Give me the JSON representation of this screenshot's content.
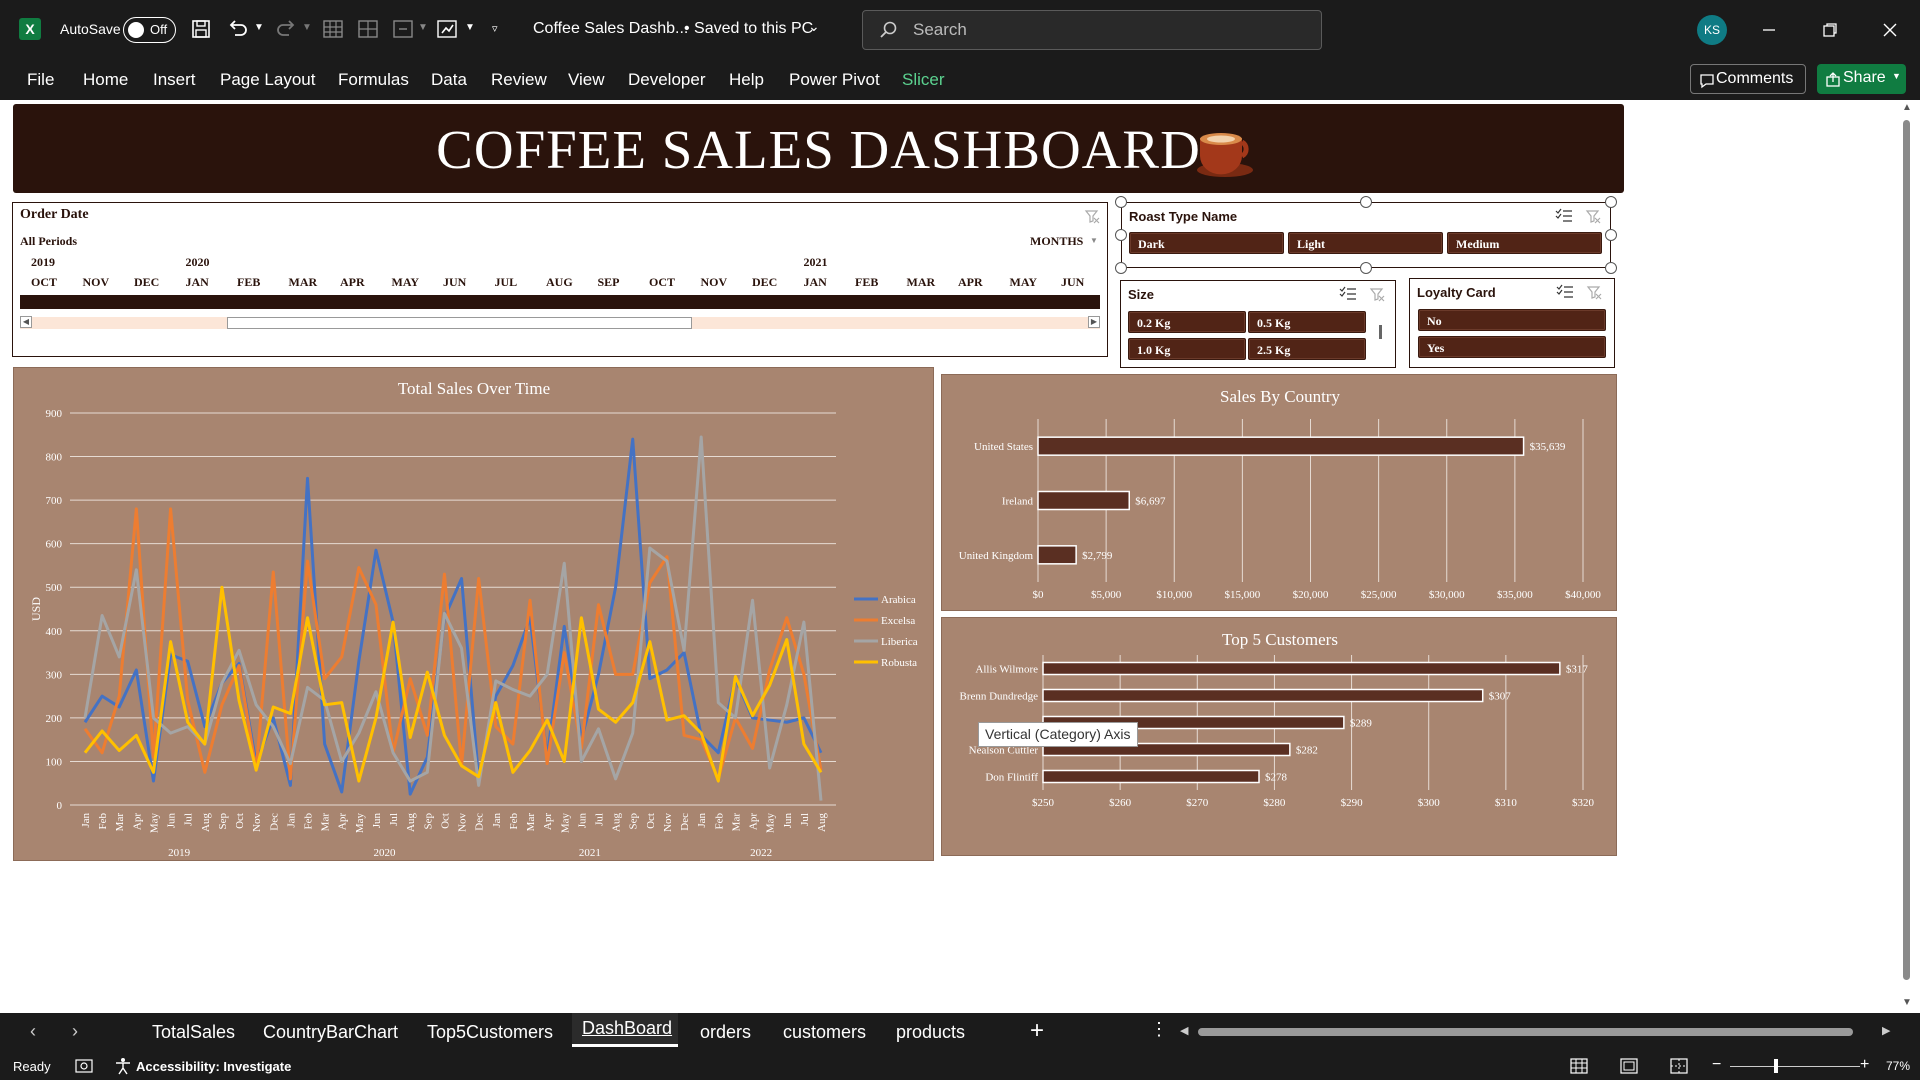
{
  "titlebar": {
    "autosave_label": "AutoSave",
    "autosave_state": "Off",
    "doc_title": "Coffee Sales Dashb...",
    "save_status": "• Saved to this PC",
    "search_placeholder": "Search",
    "user_initials": "KS"
  },
  "ribbon": {
    "tabs": [
      "File",
      "Home",
      "Insert",
      "Page Layout",
      "Formulas",
      "Data",
      "Review",
      "View",
      "Developer",
      "Help",
      "Power Pivot",
      "Slicer"
    ],
    "active_tab": "Slicer",
    "comments_label": "Comments",
    "share_label": "Share"
  },
  "dashboard": {
    "title": "COFFEE  SALES DASHBOARD"
  },
  "timeline": {
    "title": "Order Date",
    "period_label": "All Periods",
    "unit_label": "MONTHS",
    "years": [
      "2019",
      "2020",
      "2021"
    ],
    "months": [
      "OCT",
      "NOV",
      "DEC",
      "JAN",
      "FEB",
      "MAR",
      "APR",
      "MAY",
      "JUN",
      "JUL",
      "AUG",
      "SEP",
      "OCT",
      "NOV",
      "DEC",
      "JAN",
      "FEB",
      "MAR",
      "APR",
      "MAY",
      "JUN"
    ]
  },
  "slicers": {
    "roast": {
      "title": "Roast Type Name",
      "items": [
        "Dark",
        "Light",
        "Medium"
      ]
    },
    "size": {
      "title": "Size",
      "items": [
        "0.2 Kg",
        "0.5 Kg",
        "1.0 Kg",
        "2.5 Kg"
      ]
    },
    "loyalty": {
      "title": "Loyalty Card",
      "items": [
        "No",
        "Yes"
      ]
    }
  },
  "tooltip": "Vertical (Category) Axis",
  "sheet_tabs": [
    "TotalSales",
    "CountryBarChart",
    "Top5Customers",
    "DashBoard",
    "orders",
    "customers",
    "products"
  ],
  "active_sheet": "DashBoard",
  "status": {
    "ready": "Ready",
    "accessibility": "Accessibility: Investigate",
    "zoom": "77%"
  },
  "colors": {
    "banner": "#2a130c",
    "slicer_button": "#512416",
    "chart_bg": "#a88570",
    "bar_fill": "#5a2f22",
    "arabica": "#4472c4",
    "excelsa": "#ed7d31",
    "liberica": "#a5a5a5",
    "robusta": "#ffc000",
    "excel_green": "#107c41"
  },
  "chart_data": [
    {
      "type": "line",
      "title": "Total Sales Over Time",
      "ylabel": "USD",
      "ylim": [
        0,
        900
      ],
      "yticks": [
        0,
        100,
        200,
        300,
        400,
        500,
        600,
        700,
        800,
        900
      ],
      "x_months": [
        "Jan",
        "Feb",
        "Mar",
        "Apr",
        "May",
        "Jun",
        "Jul",
        "Aug",
        "Sep",
        "Oct",
        "Nov",
        "Dec",
        "Jan",
        "Feb",
        "Mar",
        "Apr",
        "May",
        "Jun",
        "Jul",
        "Aug",
        "Sep",
        "Oct",
        "Nov",
        "Dec",
        "Jan",
        "Feb",
        "Mar",
        "Apr",
        "May",
        "Jun",
        "Jul",
        "Aug",
        "Sep",
        "Oct",
        "Nov",
        "Dec",
        "Jan",
        "Feb",
        "Mar",
        "Apr",
        "May",
        "Jun",
        "Jul",
        "Aug"
      ],
      "x_years": [
        {
          "label": "2019",
          "index": 5.5
        },
        {
          "label": "2020",
          "index": 17.5
        },
        {
          "label": "2021",
          "index": 29.5
        },
        {
          "label": "2022",
          "index": 39.5
        }
      ],
      "series": [
        {
          "name": "Arabica",
          "color": "#4472c4",
          "values": [
            190,
            250,
            225,
            310,
            55,
            345,
            330,
            180,
            280,
            325,
            95,
            200,
            45,
            750,
            140,
            30,
            330,
            585,
            420,
            25,
            110,
            430,
            520,
            60,
            250,
            320,
            430,
            110,
            410,
            150,
            300,
            500,
            840,
            290,
            310,
            350,
            160,
            120,
            290,
            200,
            195,
            190,
            200,
            120
          ]
        },
        {
          "name": "Excelsa",
          "color": "#ed7d31",
          "values": [
            175,
            120,
            250,
            680,
            110,
            680,
            240,
            75,
            230,
            320,
            80,
            535,
            60,
            560,
            290,
            340,
            545,
            460,
            120,
            290,
            160,
            530,
            90,
            520,
            180,
            140,
            470,
            95,
            350,
            130,
            460,
            300,
            300,
            510,
            570,
            160,
            150,
            60,
            200,
            130,
            310,
            430,
            300,
            80
          ]
        },
        {
          "name": "Liberica",
          "color": "#a5a5a5",
          "values": [
            200,
            435,
            340,
            540,
            200,
            165,
            180,
            140,
            280,
            355,
            230,
            180,
            95,
            270,
            240,
            100,
            165,
            260,
            120,
            55,
            75,
            440,
            360,
            45,
            285,
            265,
            250,
            300,
            555,
            100,
            175,
            60,
            165,
            590,
            560,
            355,
            845,
            235,
            200,
            470,
            85,
            230,
            420,
            10
          ]
        },
        {
          "name": "Robusta",
          "color": "#ffc000",
          "values": [
            120,
            170,
            125,
            160,
            75,
            375,
            190,
            140,
            500,
            240,
            80,
            225,
            210,
            430,
            230,
            235,
            55,
            200,
            420,
            155,
            305,
            160,
            90,
            65,
            235,
            75,
            125,
            195,
            100,
            430,
            220,
            190,
            235,
            375,
            195,
            205,
            165,
            55,
            295,
            205,
            275,
            380,
            140,
            75
          ]
        }
      ],
      "legend_placement": "right"
    },
    {
      "type": "bar",
      "orientation": "horizontal",
      "title": "Sales By Country",
      "categories": [
        "United States",
        "Ireland",
        "United Kingdom"
      ],
      "values": [
        35639,
        6697,
        2799
      ],
      "data_labels": [
        "$35,639",
        "$6,697",
        "$2,799"
      ],
      "xlim": [
        0,
        40000
      ],
      "xticks": [
        "$0",
        "$5,000",
        "$10,000",
        "$15,000",
        "$20,000",
        "$25,000",
        "$30,000",
        "$35,000",
        "$40,000"
      ]
    },
    {
      "type": "bar",
      "orientation": "horizontal",
      "title": "Top 5 Customers",
      "categories": [
        "Allis Wilmore",
        "Brenn Dundredge",
        "",
        "Nealson Cuttler",
        "Don Flintiff"
      ],
      "values": [
        317,
        307,
        289,
        282,
        278
      ],
      "data_labels": [
        "$317",
        "$307",
        "$289",
        "$282",
        "$278"
      ],
      "xlim": [
        250,
        320
      ],
      "xticks": [
        "$250",
        "$260",
        "$270",
        "$280",
        "$290",
        "$300",
        "$310",
        "$320"
      ]
    }
  ]
}
